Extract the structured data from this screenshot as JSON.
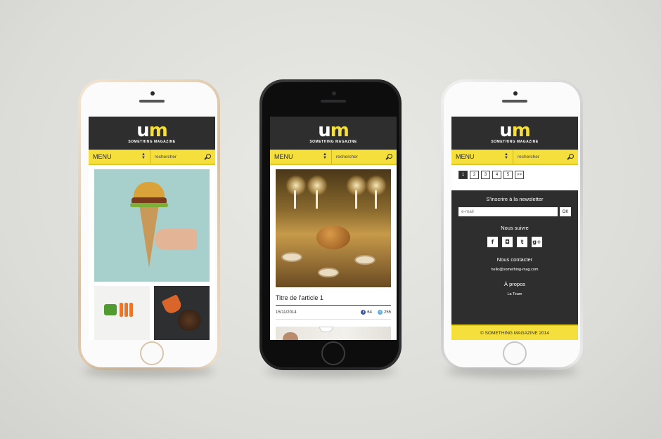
{
  "site": {
    "logo_u": "u",
    "logo_m": "m",
    "logo_sub": "SOMETHING MAGAZINE",
    "menu_label": "MENU",
    "search_placeholder": "rechercher",
    "brand_colors": {
      "accent": "#f5df3c",
      "dark": "#2e2e2e"
    }
  },
  "screen2": {
    "article_title": "Titre de l'article 1",
    "date": "15/11/2014",
    "facebook_count": "64",
    "twitter_count": "255"
  },
  "screen3": {
    "pages": [
      "1",
      "2",
      "3",
      "4",
      "5",
      ">>"
    ],
    "active_page": "1",
    "newsletter_title": "S'inscrire à la newsletter",
    "email_placeholder": "e-mail",
    "ok_label": "OK",
    "follow_title": "Nous suivre",
    "socials": [
      "facebook-icon",
      "instagram-icon",
      "twitter-icon",
      "google-plus-icon"
    ],
    "social_glyphs": {
      "facebook": "f",
      "instagram": "◘",
      "twitter": "t",
      "google": "g+"
    },
    "contact_title": "Nous contacter",
    "contact_email": "hello@something-mag.com",
    "about_title": "À propos",
    "about_link": "La Team",
    "footer": "© SOMETHING MAGAZINE 2014"
  }
}
